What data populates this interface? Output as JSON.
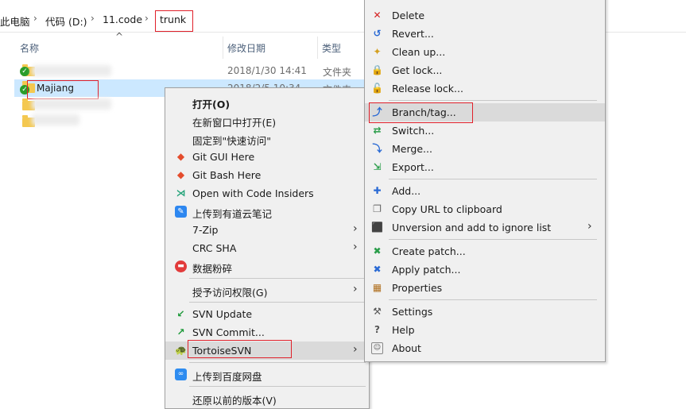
{
  "address": {
    "crumbs": [
      "此电脑",
      "代码 (D:)",
      "11.code",
      "trunk"
    ],
    "separator": "›"
  },
  "columns": {
    "name": "名称",
    "date": "修改日期",
    "type": "类型",
    "sort_arrow": "^"
  },
  "files": [
    {
      "name": "",
      "date": "2018/1/30 14:41",
      "type": "文件夹"
    },
    {
      "name": "Majiang",
      "date": "2018/2/5 10:34",
      "type": "文件夹"
    },
    {
      "name": "",
      "date": "",
      "type": ""
    },
    {
      "name": "",
      "date": "",
      "type": ""
    }
  ],
  "context_menu": {
    "items": [
      {
        "label": "打开(O)",
        "icon": ""
      },
      {
        "label": "在新窗口中打开(E)",
        "icon": ""
      },
      {
        "label": "固定到\"快速访问\"",
        "icon": ""
      },
      {
        "label": "Git GUI Here",
        "icon": "git-icon"
      },
      {
        "label": "Git Bash Here",
        "icon": "git-icon"
      },
      {
        "label": "Open with Code Insiders",
        "icon": "vscode-icon"
      },
      {
        "label": "上传到有道云笔记",
        "icon": "youdao-note-icon"
      },
      {
        "label": "7-Zip",
        "icon": ""
      },
      {
        "label": "CRC SHA",
        "icon": ""
      },
      {
        "label": "数据粉碎",
        "icon": "shredder-icon"
      },
      {
        "label": "授予访问权限(G)",
        "icon": ""
      },
      {
        "label": "SVN Update",
        "icon": "svn-update-icon"
      },
      {
        "label": "SVN Commit...",
        "icon": "svn-commit-icon"
      },
      {
        "label": "TortoiseSVN",
        "icon": "tortoise-icon"
      },
      {
        "label": "上传到百度网盘",
        "icon": "baidu-netdisk-icon"
      },
      {
        "label": "还原以前的版本(V)",
        "icon": ""
      }
    ]
  },
  "submenu": {
    "items": [
      {
        "label": "Delete",
        "icon": "delete-icon"
      },
      {
        "label": "Revert...",
        "icon": "revert-icon"
      },
      {
        "label": "Clean up...",
        "icon": "cleanup-icon"
      },
      {
        "label": "Get lock...",
        "icon": "lock-icon"
      },
      {
        "label": "Release lock...",
        "icon": "unlock-icon"
      },
      {
        "label": "Branch/tag...",
        "icon": "branch-icon"
      },
      {
        "label": "Switch...",
        "icon": "switch-icon"
      },
      {
        "label": "Merge...",
        "icon": "merge-icon"
      },
      {
        "label": "Export...",
        "icon": "export-icon"
      },
      {
        "label": "Add...",
        "icon": "add-icon"
      },
      {
        "label": "Copy URL to clipboard",
        "icon": "copy-url-icon"
      },
      {
        "label": "Unversion and add to ignore list",
        "icon": "ignore-icon"
      },
      {
        "label": "Create patch...",
        "icon": "create-patch-icon"
      },
      {
        "label": "Apply patch...",
        "icon": "apply-patch-icon"
      },
      {
        "label": "Properties",
        "icon": "properties-icon"
      },
      {
        "label": "Settings",
        "icon": "settings-icon"
      },
      {
        "label": "Help",
        "icon": "help-icon"
      },
      {
        "label": "About",
        "icon": "about-icon"
      }
    ]
  },
  "colors": {
    "selection": "#cce8ff",
    "highlight_box": "#e0202a",
    "menu_bg": "#f0f0f0"
  }
}
